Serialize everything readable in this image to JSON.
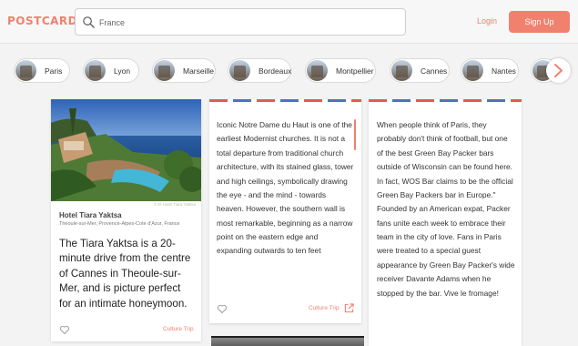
{
  "app": {
    "logo": "POSTCARD"
  },
  "search": {
    "value": "France",
    "placeholder": ""
  },
  "auth": {
    "login": "Login",
    "signup": "Sign Up"
  },
  "cities": [
    "Paris",
    "Lyon",
    "Marseille",
    "Bordeaux",
    "Montpellier",
    "Cannes",
    "Nantes"
  ],
  "cards": [
    {
      "photo_credit": "© El Hotel Tiara Yaktsa",
      "title": "Hotel Tiara Yaktsa",
      "location": "Theoule-sur-Mer, Provence-Alpes-Cote d'Azur, France",
      "text": "The Tiara Yaktsa is a 20-minute drive from the centre of Cannes in Theoule-sur-Mer, and is picture perfect for an intimate honeymoon.",
      "source": "Culture Trip"
    },
    {
      "text": "Iconic Notre Dame du Haut is one of the earliest Modernist churches. It is not a total departure from traditional church architecture, with its stained glass, tower and high ceilings, symbolically drawing the eye - and the mind - towards heaven. However, the southern wall is most remarkable, beginning as a narrow point on the eastern edge and expanding outwards to ten feet",
      "source": "Culture Trip"
    },
    {
      "text": "When people think of Paris, they probably don't think of football, but one of the best Green Bay Packer bars outside of Wisconsin can be found here. In fact, WOS Bar claims to be the official Green Bay Packers bar in Europe.\" Founded by an American expat, Packer fans unite each week to embrace their team in the city of love. Fans in Paris were treated to a special guest appearance by Green Bay Packer's wide receiver Davante Adams when he stopped by the bar. Vive le fromage!"
    }
  ],
  "colors": {
    "accent": "#f0816f",
    "airmail_red": "#e45b4e",
    "airmail_blue": "#4a72c7"
  }
}
